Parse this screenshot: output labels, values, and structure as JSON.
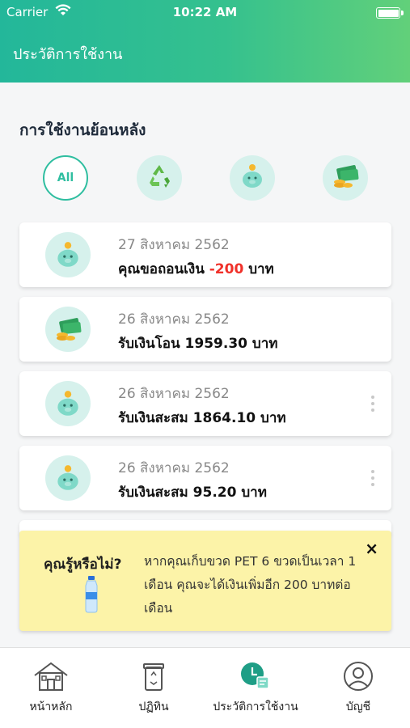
{
  "status_bar": {
    "carrier": "Carrier",
    "time": "10:22 AM"
  },
  "header": {
    "title": "ประวัติการใช้งาน"
  },
  "section": {
    "title": "การใช้งานย้อนหลัง"
  },
  "filters": [
    {
      "label": "All",
      "icon": "all-icon",
      "selected": true
    },
    {
      "label": "",
      "icon": "recycle-icon",
      "selected": false
    },
    {
      "label": "",
      "icon": "piggy-bank-icon",
      "selected": false
    },
    {
      "label": "",
      "icon": "money-icon",
      "selected": false
    }
  ],
  "transactions": [
    {
      "icon": "piggy-bank-icon",
      "date": "27 สิงหาคม 2562",
      "prefix": "คุณขอถอนเงิน ",
      "amount": "-200",
      "suffix": " บาท",
      "amount_color": "#f0312a"
    },
    {
      "icon": "money-icon",
      "date": "26 สิงหาคม 2562",
      "prefix": "รับเงินโอน ",
      "amount": "1959.30",
      "suffix": " บาท"
    },
    {
      "icon": "piggy-bank-icon",
      "date": "26 สิงหาคม 2562",
      "prefix": "รับเงินสะสม ",
      "amount": "1864.10",
      "suffix": " บาท",
      "has_menu": true
    },
    {
      "icon": "piggy-bank-icon",
      "date": "26 สิงหาคม 2562",
      "prefix": "รับเงินสะสม ",
      "amount": "95.20",
      "suffix": " บาท",
      "has_menu": true
    }
  ],
  "tip": {
    "title": "คุณรู้หรือไม่?",
    "text": "หากคุณเก็บขวด PET 6 ขวดเป็นเวลา 1 เดือน คุณจะได้เงินเพิ่มอีก 200 บาทต่อเดือน",
    "close": "×"
  },
  "tabs": [
    {
      "label": "หน้าหลัก",
      "icon": "home-icon"
    },
    {
      "label": "ปฏิทิน",
      "icon": "recycle-bin-icon"
    },
    {
      "label": "ประวัติการใช้งาน",
      "icon": "history-icon",
      "active": true
    },
    {
      "label": "บัญชี",
      "icon": "account-icon"
    }
  ],
  "colors": {
    "brand": "#2fbea0",
    "negative": "#f0312a",
    "tip_bg": "#fcf3a8"
  }
}
